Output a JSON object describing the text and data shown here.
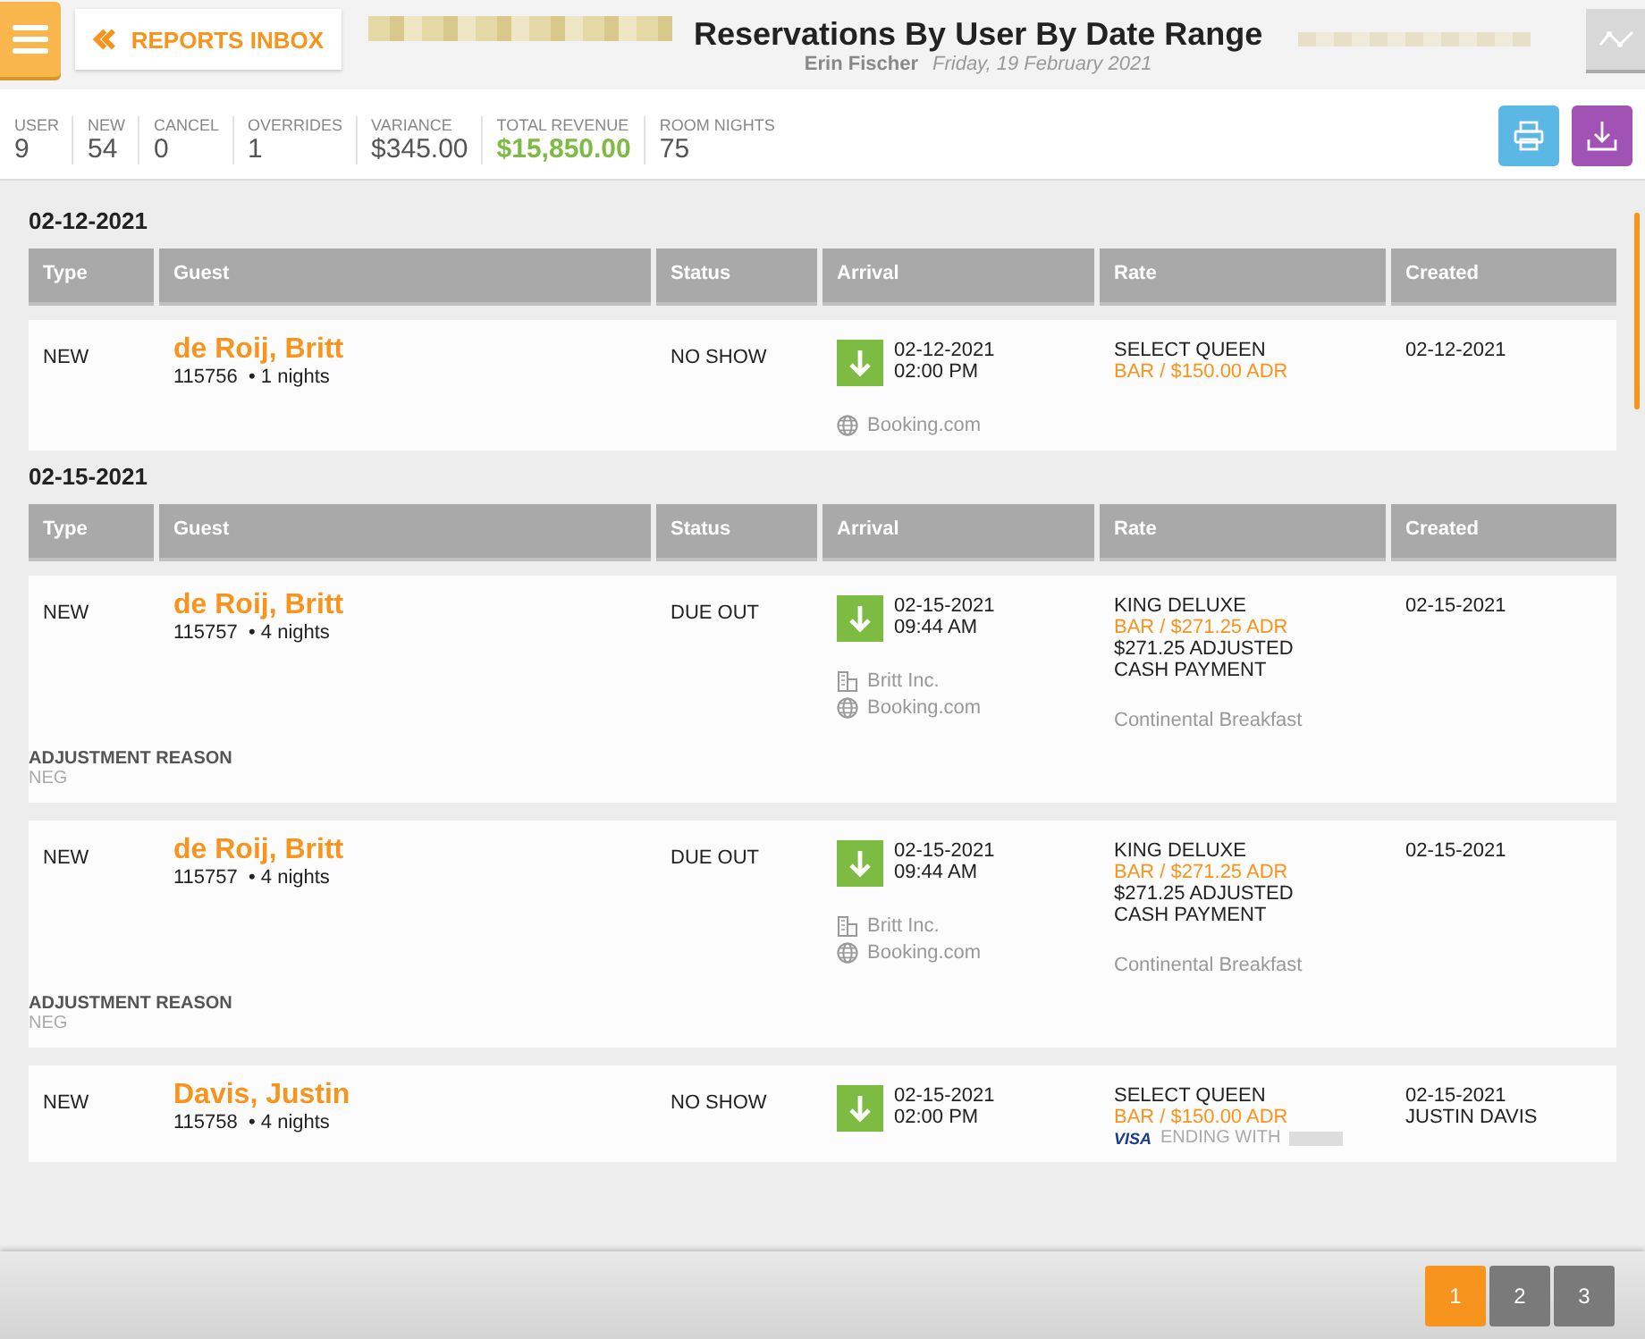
{
  "header": {
    "back_label": "REPORTS INBOX",
    "title": "Reservations By User By Date Range",
    "user": "Erin Fischer",
    "date": "Friday, 19 February 2021"
  },
  "stats": [
    {
      "label": "USER",
      "value": "9",
      "kind": "plain"
    },
    {
      "label": "NEW",
      "value": "54",
      "kind": "plain"
    },
    {
      "label": "CANCEL",
      "value": "0",
      "kind": "plain"
    },
    {
      "label": "OVERRIDES",
      "value": "1",
      "kind": "plain"
    },
    {
      "label": "VARIANCE",
      "value": "$345.00",
      "kind": "plain"
    },
    {
      "label": "TOTAL REVENUE",
      "value": "$15,850.00",
      "kind": "highlight"
    },
    {
      "label": "ROOM NIGHTS",
      "value": "75",
      "kind": "plain"
    }
  ],
  "sections": [
    {
      "date": "02-12-2021",
      "columns": [
        "Type",
        "Guest",
        "Status",
        "Arrival",
        "Rate",
        "Created"
      ],
      "rows": [
        {
          "type": "NEW",
          "guest": "de Roij, Britt",
          "id": "115756",
          "nights": "• 1 nights",
          "status": "NO SHOW",
          "arrival_date": "02-12-2021",
          "arrival_time": "02:00 PM",
          "rate_name": "SELECT QUEEN",
          "rate_bar": "BAR / $150.00 ADR",
          "sources": [
            {
              "kind": "web",
              "text": "Booking.com"
            }
          ],
          "created": "02-12-2021"
        }
      ]
    },
    {
      "date": "02-15-2021",
      "columns": [
        "Type",
        "Guest",
        "Status",
        "Arrival",
        "Rate",
        "Created"
      ],
      "rows": [
        {
          "type": "NEW",
          "guest": "de Roij, Britt",
          "id": "115757",
          "nights": "• 4 nights",
          "status": "DUE OUT",
          "arrival_date": "02-15-2021",
          "arrival_time": "09:44 AM",
          "rate_name": "KING DELUXE",
          "rate_bar": "BAR / $271.25 ADR",
          "rate_lines": [
            "$271.25 ADJUSTED",
            "CASH PAYMENT"
          ],
          "sources": [
            {
              "kind": "company",
              "text": "Britt Inc."
            },
            {
              "kind": "web",
              "text": "Booking.com"
            }
          ],
          "package": "Continental Breakfast",
          "adjustment": {
            "label": "ADJUSTMENT REASON",
            "value": "NEG"
          },
          "created": "02-15-2021"
        },
        {
          "type": "NEW",
          "guest": "de Roij, Britt",
          "id": "115757",
          "nights": "• 4 nights",
          "status": "DUE OUT",
          "arrival_date": "02-15-2021",
          "arrival_time": "09:44 AM",
          "rate_name": "KING DELUXE",
          "rate_bar": "BAR / $271.25 ADR",
          "rate_lines": [
            "$271.25 ADJUSTED",
            "CASH PAYMENT"
          ],
          "sources": [
            {
              "kind": "company",
              "text": "Britt Inc."
            },
            {
              "kind": "web",
              "text": "Booking.com"
            }
          ],
          "package": "Continental Breakfast",
          "adjustment": {
            "label": "ADJUSTMENT REASON",
            "value": "NEG"
          },
          "created": "02-15-2021"
        },
        {
          "type": "NEW",
          "guest": "Davis, Justin",
          "id": "115758",
          "nights": "• 4 nights",
          "status": "NO SHOW",
          "arrival_date": "02-15-2021",
          "arrival_time": "02:00 PM",
          "rate_name": "SELECT QUEEN",
          "rate_bar": "BAR / $150.00 ADR",
          "card": {
            "brand": "VISA",
            "text": "ENDING WITH"
          },
          "created": "02-15-2021",
          "created_by": "JUSTIN DAVIS"
        }
      ]
    }
  ],
  "pages": [
    {
      "label": "1",
      "selected": true
    },
    {
      "label": "2",
      "selected": false
    },
    {
      "label": "3",
      "selected": false
    }
  ]
}
